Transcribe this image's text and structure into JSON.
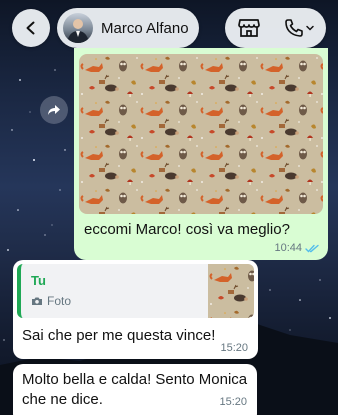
{
  "header": {
    "contact_name": "Marco Alfano",
    "back_icon": "chevron-left-icon",
    "store_icon": "storefront-icon",
    "call_icon": "phone-icon"
  },
  "messages": [
    {
      "direction": "outgoing",
      "type": "photo",
      "image": "autumn-forest-animals-pattern",
      "text": "eccomi Marco! così va meglio?",
      "time": "10:44",
      "status": "read"
    },
    {
      "direction": "incoming",
      "reply_to": {
        "author": "Tu",
        "type_label": "Foto"
      },
      "text": "Sai che per me questa vince!",
      "time": "15:20"
    },
    {
      "direction": "incoming",
      "text": "Molto bella e calda! Sento Monica che ne dice.",
      "time": "15:20"
    }
  ],
  "colors": {
    "outgoing_bubble": "#d9fdd3",
    "incoming_bubble": "#ffffff",
    "accent_green": "#1fa855",
    "read_ticks": "#53bdeb",
    "pattern_background": "#cbbda0",
    "fox_orange": "#d4622a"
  }
}
